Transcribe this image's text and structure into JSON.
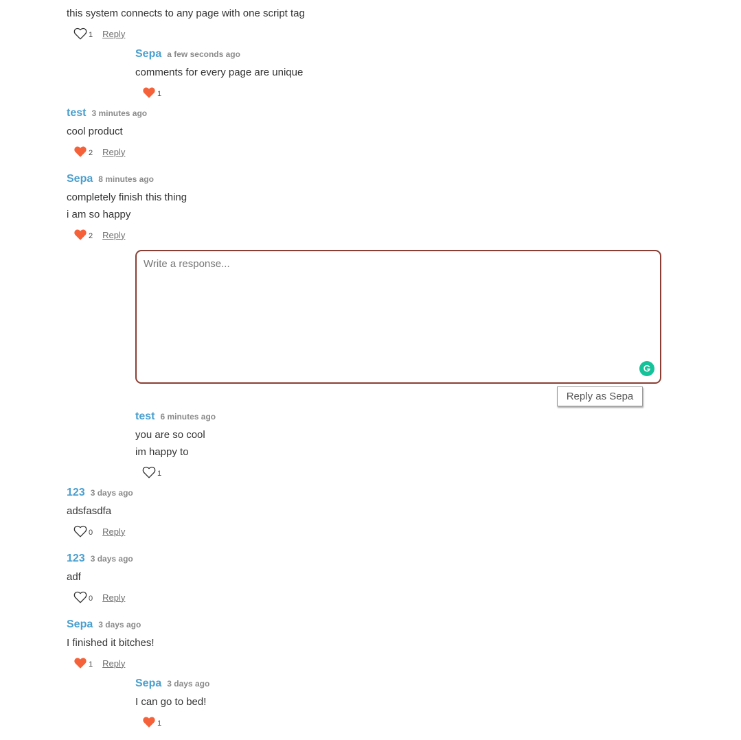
{
  "colors": {
    "author": "#4a9fce",
    "heart_filled": "#f5623a",
    "input_border": "#8a3e33",
    "grammarly": "#15c39a"
  },
  "comments": [
    {
      "author": "",
      "time": "",
      "lines": [
        "this system connects to any page with one script tag"
      ],
      "likes": "1",
      "liked": false,
      "reply_label": "Reply"
    },
    {
      "author": "Sepa",
      "time": "a few seconds ago",
      "lines": [
        "comments for every page are unique"
      ],
      "likes": "1",
      "liked": true
    },
    {
      "author": "test",
      "time": "3 minutes ago",
      "lines": [
        "cool product"
      ],
      "likes": "2",
      "liked": true,
      "reply_label": "Reply"
    },
    {
      "author": "Sepa",
      "time": "8 minutes ago",
      "lines": [
        "completely finish this thing",
        "i am so happy"
      ],
      "likes": "2",
      "liked": true,
      "reply_label": "Reply"
    },
    {
      "author": "test",
      "time": "6 minutes ago",
      "lines": [
        "you are so cool",
        "im happy to"
      ],
      "likes": "1",
      "liked": false
    },
    {
      "author": "123",
      "time": "3 days ago",
      "lines": [
        "adsfasdfa"
      ],
      "likes": "0",
      "liked": false,
      "reply_label": "Reply"
    },
    {
      "author": "123",
      "time": "3 days ago",
      "lines": [
        "adf"
      ],
      "likes": "0",
      "liked": false,
      "reply_label": "Reply"
    },
    {
      "author": "Sepa",
      "time": "3 days ago",
      "lines": [
        "I finished it bitches!"
      ],
      "likes": "1",
      "liked": true,
      "reply_label": "Reply"
    },
    {
      "author": "Sepa",
      "time": "3 days ago",
      "lines": [
        "I can go to bed!"
      ],
      "likes": "1",
      "liked": true
    }
  ],
  "reply_form": {
    "placeholder": "Write a response...",
    "value": "",
    "submit_label": "Reply as Sepa"
  }
}
